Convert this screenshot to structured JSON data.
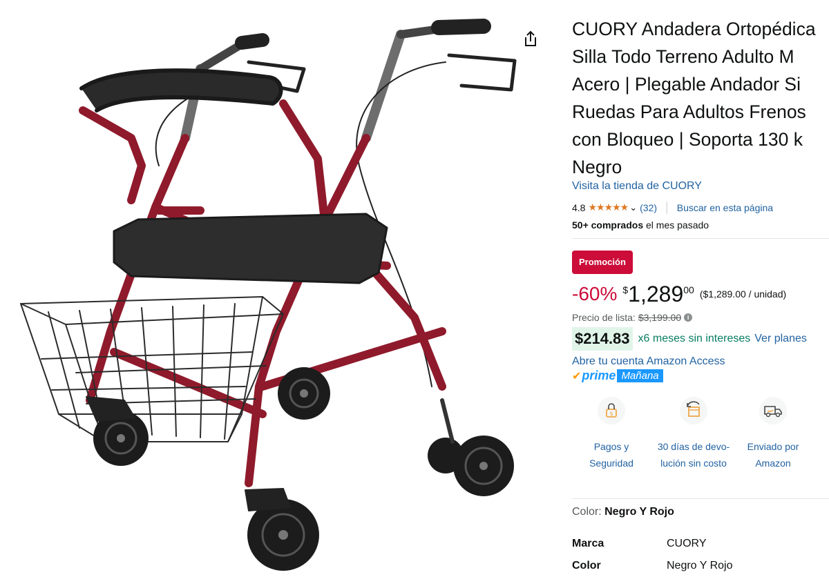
{
  "product": {
    "title_lines": [
      "CUORY Andadera Ortopédica",
      "Silla Todo Terreno Adulto M",
      "Acero | Plegable Andador Si",
      "Ruedas Para Adultos Frenos",
      "con Bloqueo | Soporta 130 k",
      "Negro"
    ],
    "store_link": "Visita la tienda de CUORY",
    "rating_value": "4.8",
    "stars": "★★★★★",
    "rating_count": "(32)",
    "search_page_link": "Buscar en esta página",
    "bought_bold": "50+ comprados",
    "bought_rest": " el mes pasado"
  },
  "pricing": {
    "badge": "Promoción",
    "discount": "-60%",
    "currency": "$",
    "whole": "1,289",
    "fraction": "00",
    "unit_price": "($1,289.00 / unidad)",
    "list_label": "Precio de lista:",
    "list_price": "$3,199.00",
    "installment_amount": "$214.83",
    "installment_text": "x6 meses sin intereses",
    "see_plans": "Ver planes",
    "access_link": "Abre tu cuenta Amazon Access",
    "prime": "prime",
    "delivery_tag": "Mañana"
  },
  "features": [
    {
      "line1": "Pagos y",
      "line2": "Seguridad",
      "icon": "secure-payment-icon"
    },
    {
      "line1": "30 días de devo-",
      "line2": "lución sin costo",
      "icon": "return-box-icon"
    },
    {
      "line1": "Enviado por",
      "line2": "Amazon",
      "icon": "delivery-truck-icon"
    }
  ],
  "variation": {
    "label": "Color: ",
    "value": "Negro Y Rojo"
  },
  "attributes": [
    {
      "key": "Marca",
      "value": "CUORY"
    },
    {
      "key": "Color",
      "value": "Negro Y Rojo"
    }
  ],
  "colors": {
    "link": "#2162a1",
    "deal_red": "#cc0c39",
    "star": "#de7921",
    "installment_green": "#067d62",
    "prime_blue": "#1a98ff",
    "frame_red": "#8f1a2b"
  }
}
